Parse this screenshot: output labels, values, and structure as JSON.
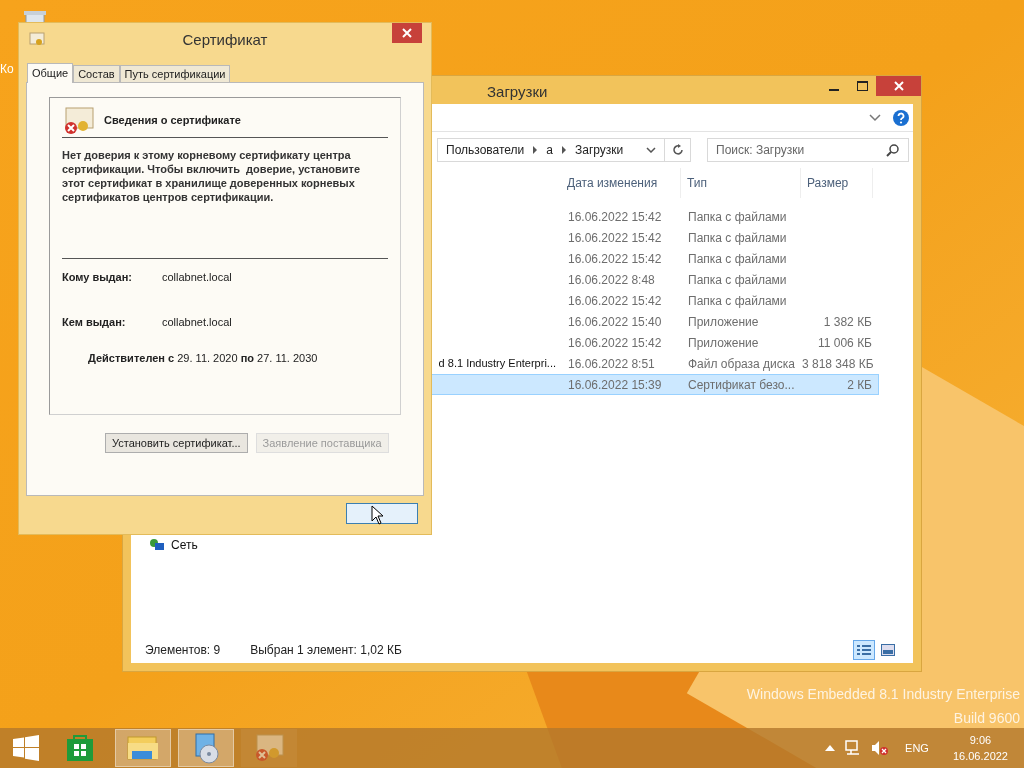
{
  "desktop": {
    "icon_label": "Ко",
    "edition_lines": [
      "Windows Embedded 8.1 Industry Enterprise",
      "Build 9600"
    ]
  },
  "explorer": {
    "title": "Загрузки",
    "breadcrumbs": [
      "Пользователи",
      "а",
      "Загрузки"
    ],
    "search": {
      "placeholder": "Поиск: Загрузки"
    },
    "columns": [
      "Дата изменения",
      "Тип",
      "Размер"
    ],
    "rows": [
      {
        "date": "16.06.2022 15:42",
        "type": "Папка с файлами",
        "size": "",
        "selected": false
      },
      {
        "date": "16.06.2022 15:42",
        "type": "Папка с файлами",
        "size": "",
        "selected": false
      },
      {
        "date": "16.06.2022 15:42",
        "type": "Папка с файлами",
        "size": "",
        "selected": false
      },
      {
        "date": "16.06.2022 8:48",
        "type": "Папка с файлами",
        "size": "",
        "selected": false
      },
      {
        "date": "16.06.2022 15:42",
        "type": "Папка с файлами",
        "size": "",
        "selected": false
      },
      {
        "date": "16.06.2022 15:40",
        "type": "Приложение",
        "size": "1 382 КБ",
        "selected": false
      },
      {
        "date": "16.06.2022 15:42",
        "type": "Приложение",
        "size": "11 006 КБ",
        "selected": false
      },
      {
        "name": "d 8.1 Industry Enterpri...",
        "date": "16.06.2022 8:51",
        "type": "Файл образа диска",
        "size": "3 818 348 КБ",
        "selected": false
      },
      {
        "date": "16.06.2022 15:39",
        "type": "Сертификат безо...",
        "size": "2 КБ",
        "selected": true
      }
    ],
    "nav": [
      {
        "label": "Сеть"
      }
    ],
    "status": [
      "Элементов: 9",
      "Выбран 1 элемент: 1,02 КБ"
    ],
    "views": [
      {
        "kind": "details",
        "selected": true
      },
      {
        "kind": "tiles",
        "selected": false
      }
    ]
  },
  "dialog": {
    "title": "Сертификат",
    "tabs": [
      {
        "label": "Общие",
        "selected": true
      },
      {
        "label": "Состав",
        "selected": false
      },
      {
        "label": "Путь сертификации",
        "selected": false
      }
    ],
    "heading": "Сведения о сертификате",
    "message": "Нет доверия к этому корневому сертификату центра сертификации. Чтобы включить  доверие, установите этот сертификат в хранилище доверенных корневых сертификатов центров сертификации.",
    "fields": [
      {
        "label": "Кому выдан:",
        "value": "collabnet.local"
      },
      {
        "label": "Кем выдан:",
        "value": "collabnet.local"
      }
    ],
    "validity": "**Действителен с** 29. 11. 2020 **по** 27. 11. 2030",
    "buttons": [
      {
        "label": "Установить сертификат...",
        "disabled": false
      },
      {
        "label": "Заявление поставщика",
        "disabled": true
      }
    ]
  },
  "taskbar": {
    "apps": [
      {
        "kind": "store",
        "active": false
      },
      {
        "kind": "explorer",
        "active": true
      },
      {
        "kind": "control",
        "active": true
      },
      {
        "kind": "certificate",
        "active": false
      }
    ],
    "language": "ENG",
    "time": "9:06",
    "date": "16.06.2022"
  }
}
